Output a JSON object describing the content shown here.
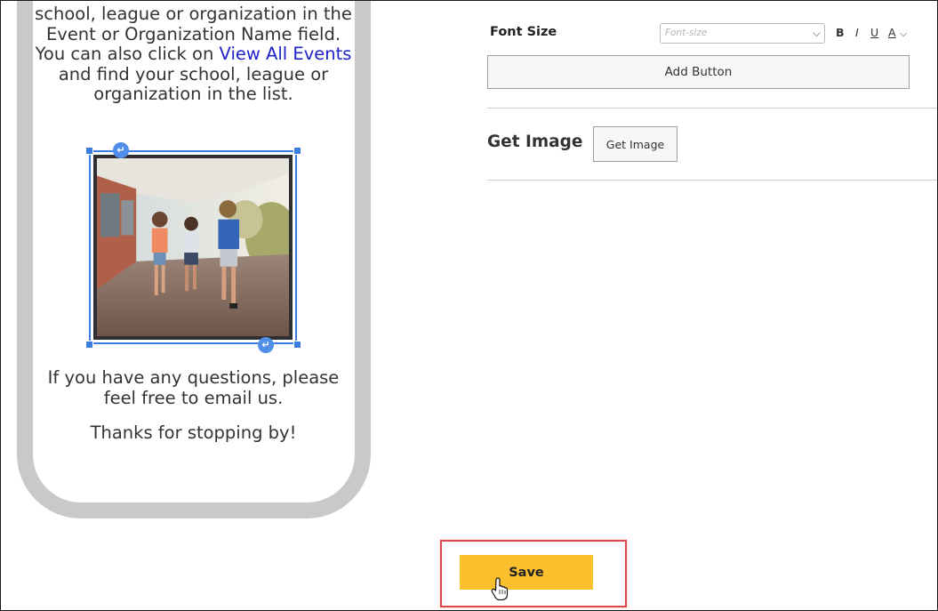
{
  "phone_preview": {
    "intro_before_link": "school, league or organization in the Event or Organization Name field. You can also click on ",
    "intro_link": "View All Events",
    "intro_after_link": " and find your school, league or organization in the list.",
    "questions_text": "If you have any questions, please feel free to email us.",
    "thanks_text": "Thanks for stopping by!",
    "image_badge_glyph": "↵"
  },
  "editor": {
    "font_size_label": "Font Size",
    "font_size_placeholder": "Font-size",
    "bold_label": "B",
    "italic_label": "I",
    "underline_label": "U",
    "color_label": "A",
    "add_button_label": "Add Button",
    "get_image_label": "Get Image",
    "get_image_button_label": "Get Image"
  },
  "footer": {
    "save_label": "Save"
  },
  "colors": {
    "save_button": "#fbc02d",
    "highlight_box": "#e0474b",
    "link": "#1e22c8",
    "selection": "#3b7de0",
    "phone_frame": "#c9c9c9"
  },
  "icons": [
    "chevron-down-icon",
    "text-color-icon",
    "enter-icon",
    "hand-pointer-icon"
  ]
}
